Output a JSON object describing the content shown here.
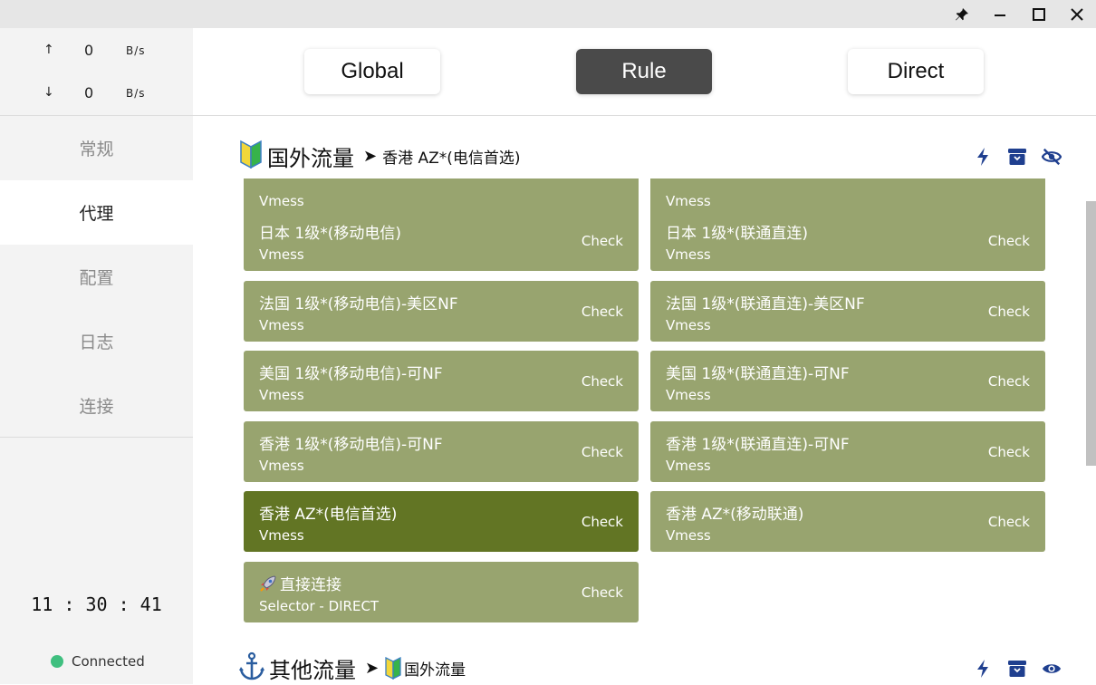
{
  "window": {
    "controls": {
      "pin": "pin-icon",
      "minimize": "minimize-icon",
      "maximize": "maximize-icon",
      "close": "close-icon"
    }
  },
  "traffic": {
    "up": {
      "arrow": "↑",
      "value": "0",
      "unit": "B/s"
    },
    "down": {
      "arrow": "↓",
      "value": "0",
      "unit": "B/s"
    }
  },
  "nav": {
    "items": [
      {
        "label": "常规",
        "active": false
      },
      {
        "label": "代理",
        "active": true
      },
      {
        "label": "配置",
        "active": false
      },
      {
        "label": "日志",
        "active": false
      },
      {
        "label": "连接",
        "active": false
      }
    ]
  },
  "clock": "11 : 30 : 41",
  "status": {
    "label": "Connected",
    "color": "#3fbf7f"
  },
  "modes": [
    {
      "label": "Global",
      "active": false
    },
    {
      "label": "Rule",
      "active": true
    },
    {
      "label": "Direct",
      "active": false
    }
  ],
  "groups": [
    {
      "icon": "beginner-badge-icon",
      "name": "国外流量",
      "separator": "➤",
      "selected": "香港 AZ*(电信首选)",
      "actions": {
        "latency": "bolt-icon",
        "collapse": "archive-icon",
        "visibility": "eye-slash-icon"
      }
    },
    {
      "icon": "anchor-icon",
      "name": "其他流量",
      "separator": "➤",
      "selected_icon": "beginner-badge-icon",
      "selected": "国外流量",
      "actions": {
        "latency": "bolt-icon",
        "collapse": "archive-icon",
        "visibility": "eye-icon"
      }
    }
  ],
  "proxies": {
    "check_label": "Check",
    "items": [
      {
        "name": "",
        "type": "Vmess",
        "selected": false
      },
      {
        "name": "",
        "type": "Vmess",
        "selected": false
      },
      {
        "name": "日本 1级*(移动电信)",
        "type": "Vmess",
        "selected": false
      },
      {
        "name": "日本 1级*(联通直连)",
        "type": "Vmess",
        "selected": false
      },
      {
        "name": "法国 1级*(移动电信)-美区NF",
        "type": "Vmess",
        "selected": false
      },
      {
        "name": "法国 1级*(联通直连)-美区NF",
        "type": "Vmess",
        "selected": false
      },
      {
        "name": "美国 1级*(移动电信)-可NF",
        "type": "Vmess",
        "selected": false
      },
      {
        "name": "美国 1级*(联通直连)-可NF",
        "type": "Vmess",
        "selected": false
      },
      {
        "name": "香港 1级*(移动电信)-可NF",
        "type": "Vmess",
        "selected": false
      },
      {
        "name": "香港 1级*(联通直连)-可NF",
        "type": "Vmess",
        "selected": false
      },
      {
        "name": "香港 AZ*(电信首选)",
        "type": "Vmess",
        "selected": true
      },
      {
        "name": "香港 AZ*(移动联通)",
        "type": "Vmess",
        "selected": false
      },
      {
        "name": "直接连接",
        "icon": "rocket-icon",
        "type": "Selector - DIRECT",
        "selected": false
      }
    ]
  },
  "colors": {
    "card": "#98a46f",
    "card_selected": "#627524",
    "mode_active": "#4a4a4a",
    "icon_blue": "#1f3f8f"
  }
}
